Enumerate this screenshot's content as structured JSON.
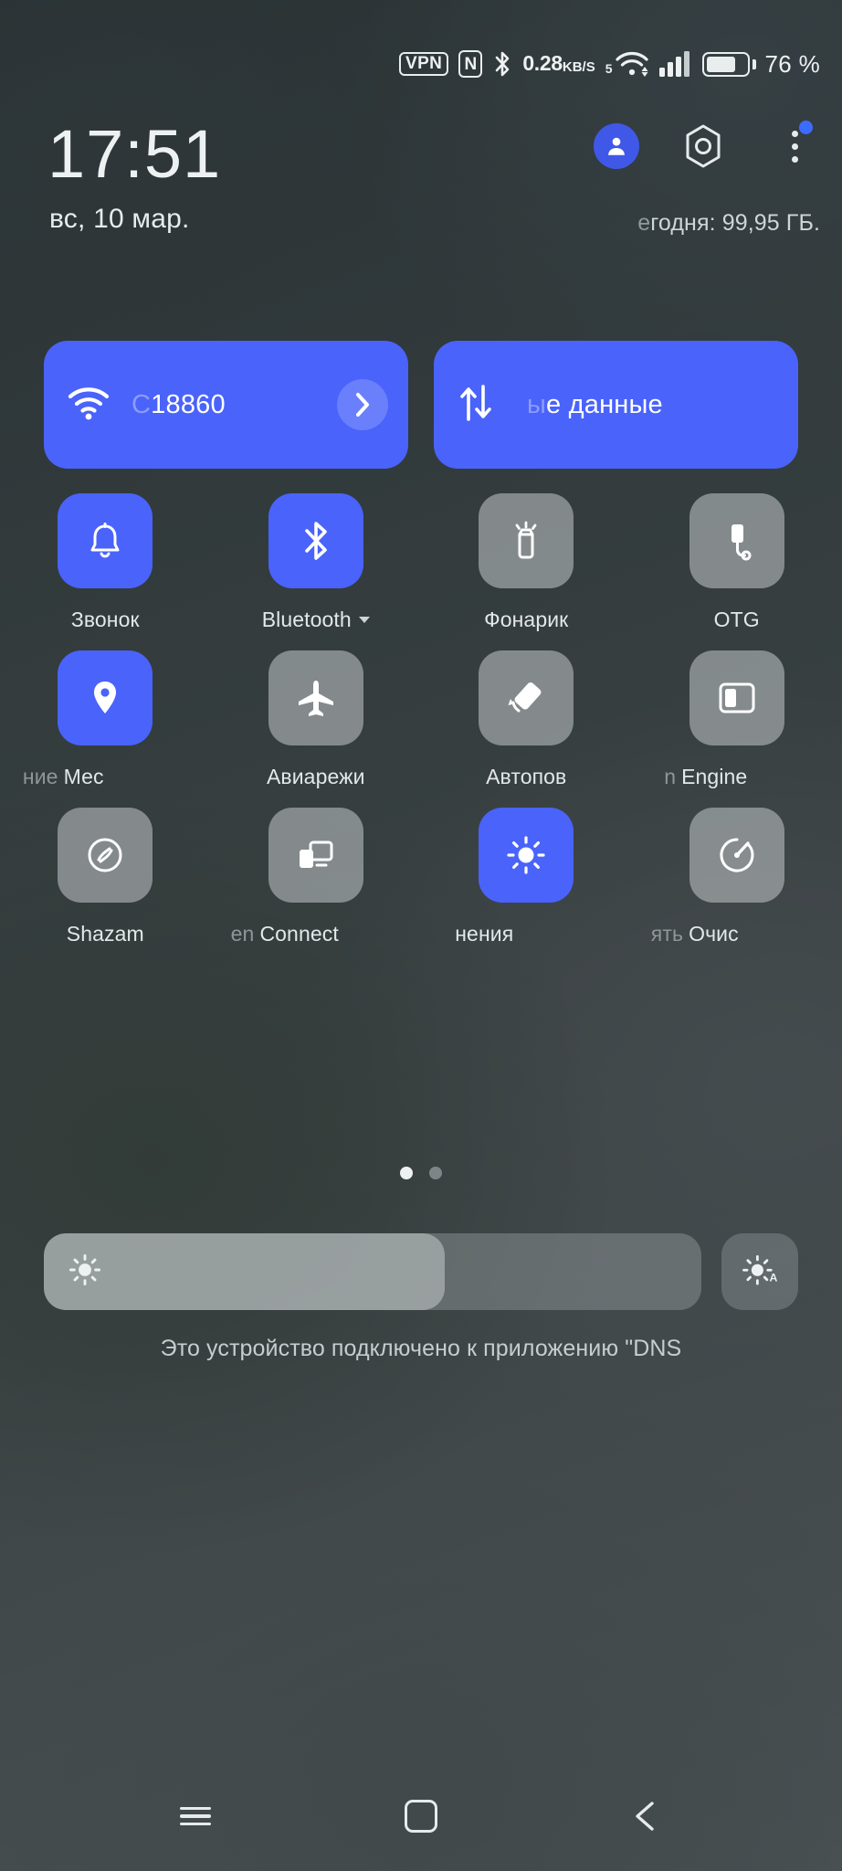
{
  "status_bar": {
    "vpn_label": "VPN",
    "nfc_label": "N",
    "bluetooth_icon": "bluetooth-icon",
    "net_speed_value": "0.28",
    "net_speed_unit": "KB/S",
    "wifi_generation": "5",
    "wifi_icon": "wifi-icon",
    "signal_icon": "cellular-signal-icon",
    "battery_percent": "76 %",
    "battery_level": 76
  },
  "header": {
    "time": "17:51",
    "date": "вс, 10 мар.",
    "avatar_icon": "user-avatar-icon",
    "settings_icon": "gear-icon",
    "overflow_icon": "more-options-icon",
    "has_notification_badge": true,
    "usage_faded": "е",
    "usage_text": "годня: 99,95 ГБ."
  },
  "wide_tiles": [
    {
      "name": "wifi",
      "icon": "wifi-icon",
      "ghost_prefix": "C",
      "label": "18860",
      "active": true,
      "has_chevron": true,
      "chevron_icon": "chevron-right-icon"
    },
    {
      "name": "mobile-data",
      "icon": "data-transfer-icon",
      "ghost_prefix": "ы",
      "label": "е данные",
      "active": true,
      "has_chevron": false
    }
  ],
  "toggle_rows": [
    [
      {
        "name": "ringer",
        "icon": "bell-icon",
        "label": "Звонок",
        "ghost_prefix": "",
        "active": true,
        "has_caret": false,
        "shift": ""
      },
      {
        "name": "bluetooth",
        "icon": "bluetooth-icon",
        "label": "Bluetooth",
        "ghost_prefix": "",
        "active": true,
        "has_caret": true,
        "shift": ""
      },
      {
        "name": "flashlight",
        "icon": "flashlight-icon",
        "label": "Фонарик",
        "ghost_prefix": "",
        "active": false,
        "has_caret": false,
        "shift": ""
      },
      {
        "name": "otg",
        "icon": "otg-icon",
        "label": "OTG",
        "ghost_prefix": "",
        "active": false,
        "has_caret": false,
        "shift": ""
      }
    ],
    [
      {
        "name": "location",
        "icon": "location-pin-icon",
        "label": "Мес",
        "ghost_prefix": "ние ",
        "active": true,
        "has_caret": false,
        "shift": "lbl-shift-l"
      },
      {
        "name": "airplane",
        "icon": "airplane-icon",
        "label": "Авиарежи",
        "ghost_prefix": "",
        "active": false,
        "has_caret": false,
        "shift": ""
      },
      {
        "name": "auto-rotate",
        "icon": "auto-rotate-icon",
        "label": "Автопов",
        "ghost_prefix": "",
        "active": false,
        "has_caret": false,
        "shift": ""
      },
      {
        "name": "engine-mode",
        "icon": "split-screen-icon",
        "label": "Engine",
        "ghost_prefix": "n ",
        "active": false,
        "has_caret": false,
        "shift": "lbl-shift-l2"
      }
    ],
    [
      {
        "name": "shazam",
        "icon": "shazam-icon",
        "label": "Shazam",
        "ghost_prefix": "",
        "active": false,
        "has_caret": false,
        "shift": ""
      },
      {
        "name": "screen-cast",
        "icon": "cast-icon",
        "label": "Connect",
        "ghost_prefix": "en ",
        "active": false,
        "has_caret": false,
        "shift": "lbl-shift-l2"
      },
      {
        "name": "eye-comfort",
        "icon": "brightness-icon",
        "label": "нения",
        "ghost_prefix": "",
        "active": true,
        "has_caret": false,
        "shift": "lbl-shift-l"
      },
      {
        "name": "clean-up",
        "icon": "optimize-icon",
        "label": "Очис",
        "ghost_prefix": "ять ",
        "active": false,
        "has_caret": false,
        "shift": "lbl-shift-l"
      }
    ]
  ],
  "pagination": {
    "total": 2,
    "active_index": 0
  },
  "brightness": {
    "icon": "brightness-icon",
    "level_percent": 61,
    "auto_button_icon": "auto-brightness-icon",
    "auto_label": "A"
  },
  "footer": {
    "note": "Это устройство подключено к приложению \"DNS"
  },
  "nav_bar": {
    "recents_label": "recents-icon",
    "home_label": "home-icon",
    "back_label": "back-icon"
  },
  "colors": {
    "accent": "#4a63fb",
    "tile_off": "rgba(180,186,188,0.62)",
    "text_primary": "#eef1f2"
  }
}
